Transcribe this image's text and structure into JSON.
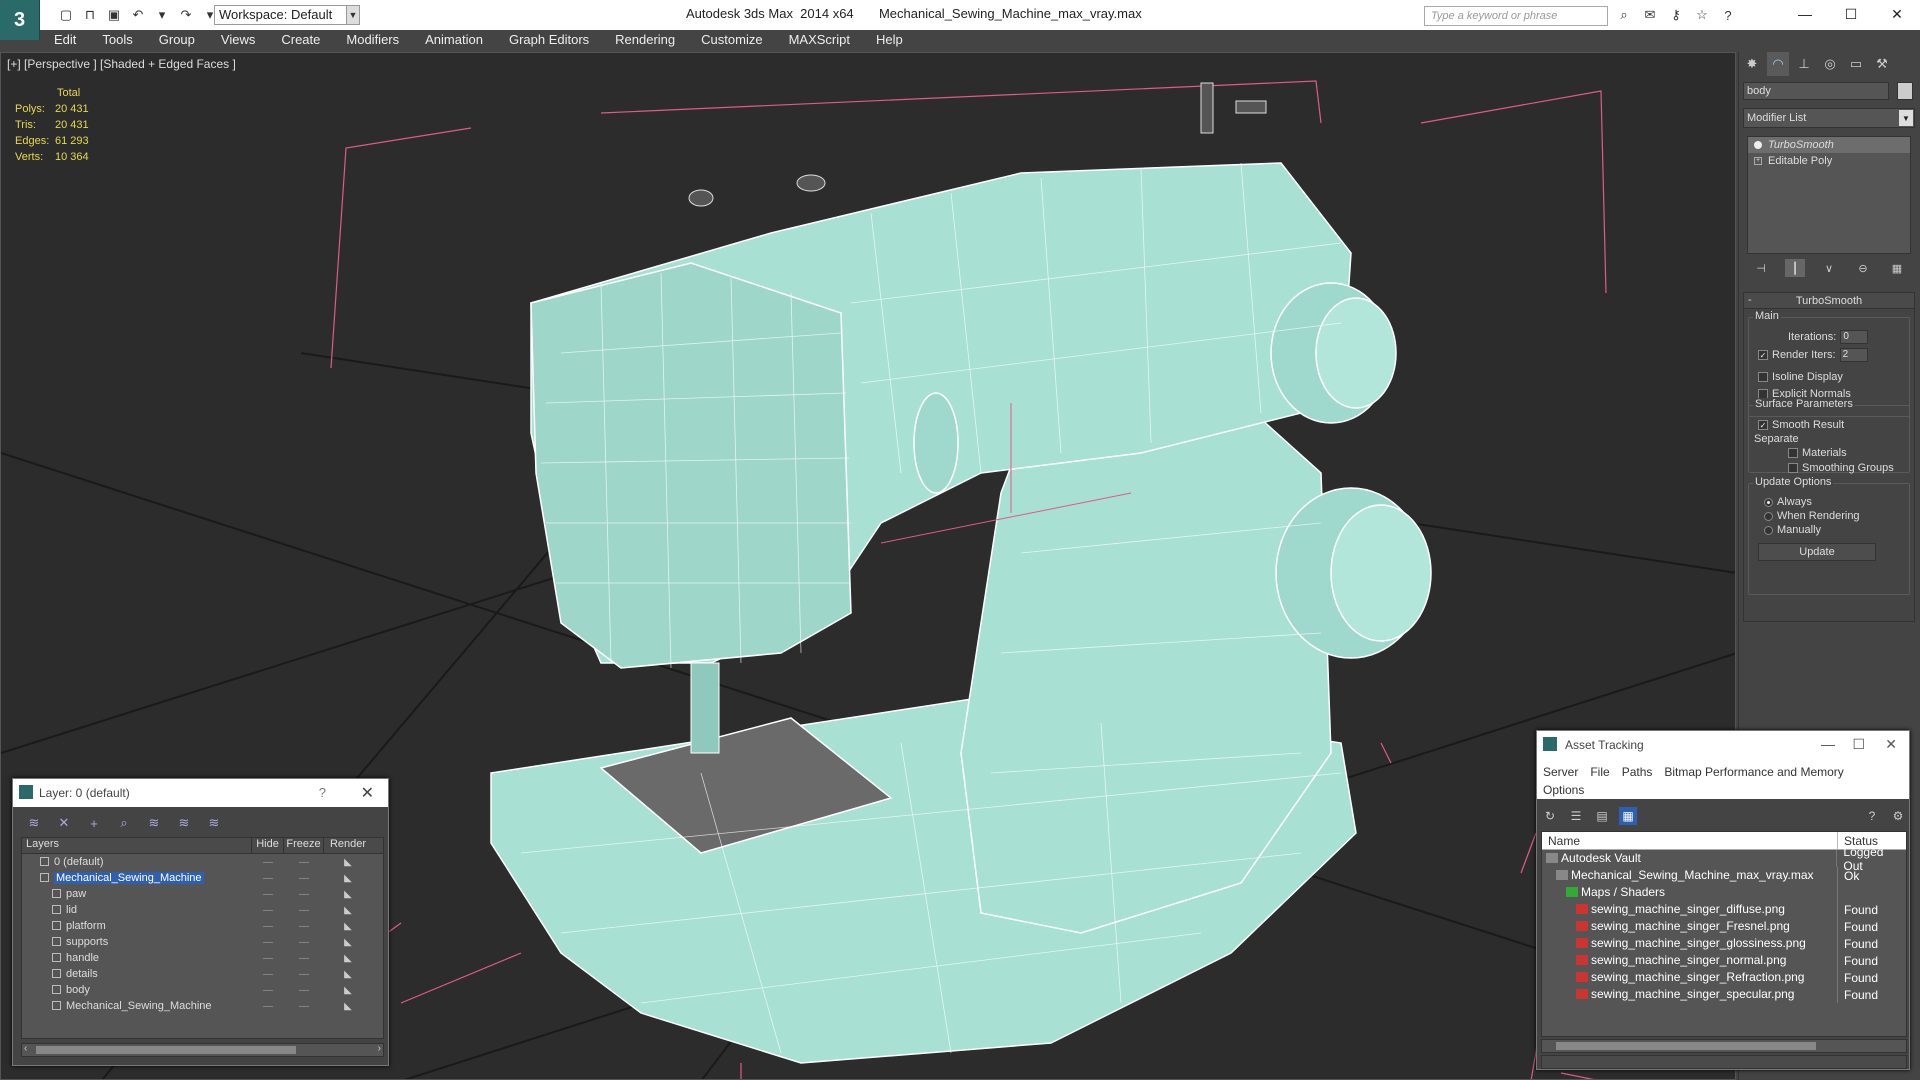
{
  "app": {
    "logo": "3",
    "title": "Autodesk 3ds Max  2014 x64       Mechanical_Sewing_Machine_max_vray.max",
    "workspace": "Workspace: Default",
    "search_placeholder": "Type a keyword or phrase"
  },
  "menu": [
    "Edit",
    "Tools",
    "Group",
    "Views",
    "Create",
    "Modifiers",
    "Animation",
    "Graph Editors",
    "Rendering",
    "Customize",
    "MAXScript",
    "Help"
  ],
  "viewport": {
    "label": "[+] [Perspective ] [Shaded + Edged Faces ]",
    "stats": {
      "header": "Total",
      "rows": [
        {
          "k": "Polys:",
          "v": "20 431"
        },
        {
          "k": "Tris:",
          "v": "20 431"
        },
        {
          "k": "Edges:",
          "v": "61 293"
        },
        {
          "k": "Verts:",
          "v": "10 364"
        }
      ]
    },
    "mesh_color": "#a8e0d4"
  },
  "command_panel": {
    "object_name": "body",
    "modifier_list": "Modifier List",
    "stack": [
      "TurboSmooth",
      "Editable Poly"
    ],
    "rollout_title": "TurboSmooth",
    "main_label": "Main",
    "iterations_label": "Iterations:",
    "iterations_value": "0",
    "render_iters_label": "Render Iters:",
    "render_iters_value": "2",
    "isoline": "Isoline Display",
    "explicit_normals": "Explicit Normals",
    "surface_params": "Surface Parameters",
    "smooth_result": "Smooth Result",
    "separate": "Separate",
    "materials": "Materials",
    "smoothing_groups": "Smoothing Groups",
    "update_options": "Update Options",
    "always": "Always",
    "when_rendering": "When Rendering",
    "manually": "Manually",
    "update_button": "Update"
  },
  "layer_dialog": {
    "title": "Layer: 0 (default)",
    "columns": [
      "Layers",
      "Hide",
      "Freeze",
      "Render"
    ],
    "rows": [
      {
        "name": "0 (default)",
        "indent": 1
      },
      {
        "name": "Mechanical_Sewing_Machine",
        "indent": 1
      },
      {
        "name": "paw",
        "indent": 2
      },
      {
        "name": "lid",
        "indent": 2
      },
      {
        "name": "platform",
        "indent": 2
      },
      {
        "name": "supports",
        "indent": 2
      },
      {
        "name": "handle",
        "indent": 2
      },
      {
        "name": "details",
        "indent": 2
      },
      {
        "name": "body",
        "indent": 2
      },
      {
        "name": "Mechanical_Sewing_Machine",
        "indent": 2
      }
    ]
  },
  "asset_dialog": {
    "title": "Asset Tracking",
    "menu_line1": [
      "Server",
      "File",
      "Paths",
      "Bitmap Performance and Memory"
    ],
    "menu_line2": [
      "Options"
    ],
    "columns": [
      "Name",
      "Status"
    ],
    "rows": [
      {
        "name": "Autodesk Vault",
        "status": "Logged Out",
        "indent": 1
      },
      {
        "name": "Mechanical_Sewing_Machine_max_vray.max",
        "status": "Ok",
        "indent": 2
      },
      {
        "name": "Maps / Shaders",
        "status": "",
        "indent": 3
      },
      {
        "name": "sewing_machine_singer_diffuse.png",
        "status": "Found",
        "indent": 4
      },
      {
        "name": "sewing_machine_singer_Fresnel.png",
        "status": "Found",
        "indent": 4
      },
      {
        "name": "sewing_machine_singer_glossiness.png",
        "status": "Found",
        "indent": 4
      },
      {
        "name": "sewing_machine_singer_normal.png",
        "status": "Found",
        "indent": 4
      },
      {
        "name": "sewing_machine_singer_Refraction.png",
        "status": "Found",
        "indent": 4
      },
      {
        "name": "sewing_machine_singer_specular.png",
        "status": "Found",
        "indent": 4
      }
    ]
  }
}
